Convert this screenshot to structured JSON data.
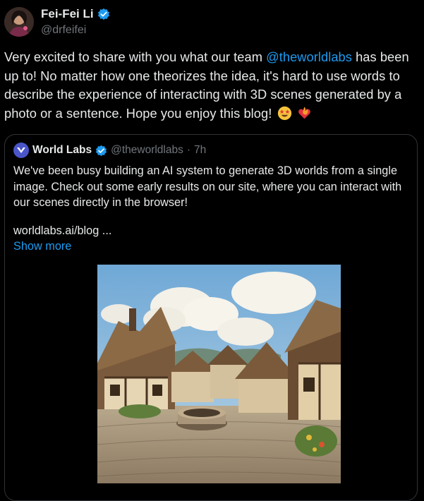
{
  "author": {
    "name": "Fei-Fei Li",
    "handle": "@drfeifei"
  },
  "tweet": {
    "text_before": "Very excited to share with you what our team ",
    "mention": "@theworldlabs",
    "text_after": " has been up to! No matter how one theorizes the idea, it's hard to use words to describe the experience of interacting with 3D scenes generated by a photo or a sentence. Hope you enjoy this blog!",
    "emojis": [
      "star-struck-emoji",
      "fire-heart-emoji"
    ]
  },
  "quote": {
    "name": "World Labs",
    "handle": "@theworldlabs",
    "separator": "·",
    "time": "7h",
    "text": "We've been busy building an AI system to generate 3D worlds from a single image. Check out some early results on our site, where you can interact with our scenes directly in the browser!",
    "link": "worldlabs.ai/blog ...",
    "show_more": "Show more",
    "image_icon": "village-scene-image"
  },
  "colors": {
    "background": "#000000",
    "text": "#e7e9ea",
    "muted": "#71767b",
    "accent": "#1d9bf0",
    "border": "#2f3336"
  }
}
